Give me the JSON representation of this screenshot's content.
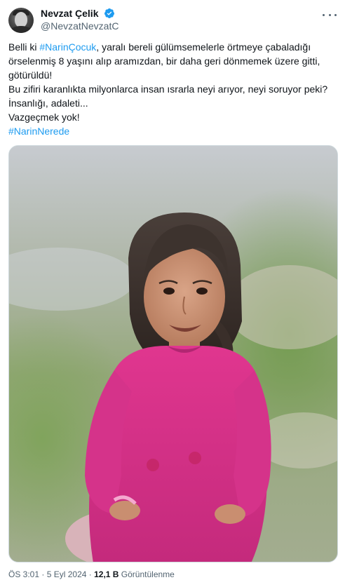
{
  "author": {
    "display_name": "Nevzat Çelik",
    "handle": "@NevzatNevzatC",
    "verified": true,
    "verified_color": "#1d9bf0"
  },
  "tweet": {
    "line1_prefix": "Belli ki ",
    "line1_hashtag": "#NarinÇocuk",
    "line1_suffix": ", yaralı bereli gülümsemelerle örtmeye çabaladığı",
    "line2": "örselenmiş 8 yaşını alıp aramızdan, bir daha geri dönmemek üzere gitti,",
    "line3": "götürüldü!",
    "line4": "Bu zifiri karanlıkta milyonlarca insan ısrarla neyi arıyor, neyi soruyor peki?",
    "line5": "İnsanlığı, adaleti...",
    "line6": "Vazgeçmek yok!",
    "line7_hashtag": "#NarinNerede",
    "hashtag_color": "#1d9bf0"
  },
  "media": {
    "icon": "photo-of-smiling-girl-in-pink-sweater"
  },
  "meta": {
    "time": "ÖS 3:01",
    "separator1": " · ",
    "date": "5 Eyl 2024",
    "separator2": " · ",
    "views_count": "12,1 B",
    "views_label": " Görüntülenme"
  },
  "icons": {
    "more": "more-options-icon",
    "verified": "verified-badge-icon"
  }
}
